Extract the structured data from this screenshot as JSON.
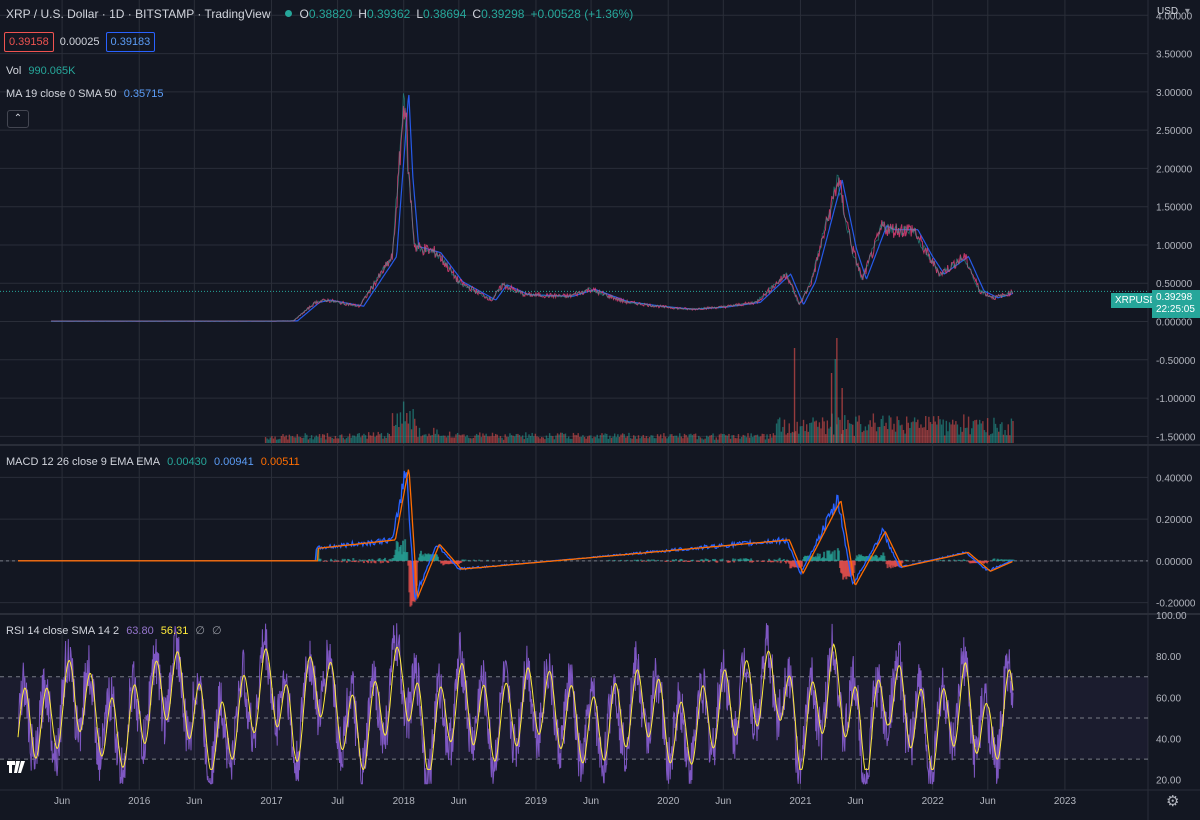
{
  "header": {
    "title": "XRP / U.S. Dollar · 1D · BITSTAMP · TradingView",
    "ohlc": [
      {
        "k": "O",
        "v": "0.38820"
      },
      {
        "k": "H",
        "v": "0.39362"
      },
      {
        "k": "L",
        "v": "0.38694"
      },
      {
        "k": "C",
        "v": "0.39298"
      }
    ],
    "change": "+0.00528 (+1.36%)",
    "bid": "0.39158",
    "spread": "0.00025",
    "ask": "0.39183"
  },
  "indicators": {
    "vol_label": "Vol",
    "vol_value": "990.065K",
    "ma_label": "MA 19 close 0 SMA 50",
    "ma_value": "0.35715",
    "macd_label": "MACD 12 26 close 9 EMA EMA",
    "macd_values": [
      "0.00430",
      "0.00941",
      "0.00511"
    ],
    "rsi_label": "RSI 14 close SMA 14 2",
    "rsi_values": [
      "63.80",
      "56.31",
      "∅",
      "∅"
    ]
  },
  "price_axis": {
    "currency": "USD",
    "ticks": [
      "4.00000",
      "3.50000",
      "3.00000",
      "2.50000",
      "2.00000",
      "1.50000",
      "1.00000",
      "0.50000",
      "0.00000",
      "-0.50000",
      "-1.00000",
      "-1.50000"
    ],
    "symbol_tag": "XRPUSD",
    "last_price": "0.39298",
    "countdown": "22:25:05"
  },
  "macd_axis": {
    "ticks": [
      "0.40000",
      "0.20000",
      "0.00000",
      "-0.20000"
    ]
  },
  "rsi_axis": {
    "ticks": [
      "100.00",
      "80.00",
      "60.00",
      "40.00",
      "20.00"
    ]
  },
  "time_axis": [
    "Jun",
    "2016",
    "Jun",
    "2017",
    "Jul",
    "2018",
    "Jun",
    "2019",
    "Jun",
    "2020",
    "Jun",
    "2021",
    "Jun",
    "2022",
    "Jun",
    "2023"
  ],
  "colors": {
    "background": "#131722",
    "grid": "#2a2e39",
    "up": "#26a69a",
    "down": "#ef5350",
    "macd_line": "#2962ff",
    "signal_line": "#ff6d00",
    "rsi_line": "#7e57c2",
    "rsi_ma": "#ffeb3b",
    "ma_line": "#2962ff"
  },
  "chart_data": [
    {
      "type": "line",
      "name": "price",
      "x": [
        "2015-05",
        "2016-01",
        "2016-06",
        "2017-01",
        "2017-03",
        "2017-05",
        "2017-06",
        "2017-09",
        "2017-12",
        "2018-01-04",
        "2018-01-15",
        "2018-02",
        "2018-04",
        "2018-06",
        "2018-09",
        "2018-10",
        "2018-12",
        "2019-04",
        "2019-06",
        "2019-09",
        "2019-12",
        "2020-03",
        "2020-06",
        "2020-09",
        "2020-11-24",
        "2020-12-29",
        "2021-02-01",
        "2021-04-14",
        "2021-05-23",
        "2021-06-20",
        "2021-08-15",
        "2021-09-06",
        "2021-11-10",
        "2021-12-20",
        "2022-01-22",
        "2022-03-28",
        "2022-05-10",
        "2022-06-18",
        "2022-07-20",
        "2022-08-11"
      ],
      "y": [
        0.006,
        0.006,
        0.006,
        0.006,
        0.008,
        0.25,
        0.28,
        0.2,
        0.85,
        3.0,
        1.9,
        0.98,
        0.9,
        0.52,
        0.28,
        0.48,
        0.35,
        0.33,
        0.42,
        0.26,
        0.2,
        0.16,
        0.19,
        0.25,
        0.62,
        0.22,
        0.52,
        1.85,
        0.95,
        0.55,
        1.25,
        1.2,
        1.2,
        0.85,
        0.62,
        0.85,
        0.4,
        0.31,
        0.35,
        0.39298
      ],
      "ylim": [
        -1.6,
        4.2
      ]
    },
    {
      "type": "line",
      "name": "MACD",
      "x": [
        "2017-05",
        "2017-12",
        "2018-01-08",
        "2018-02",
        "2018-04",
        "2018-06",
        "2020-11-24",
        "2021-01",
        "2021-04-14",
        "2021-05-23",
        "2021-08-15",
        "2021-10",
        "2022-04",
        "2022-06",
        "2022-08-11"
      ],
      "y": [
        0.06,
        0.1,
        0.45,
        -0.18,
        0.08,
        -0.04,
        0.1,
        -0.06,
        0.29,
        -0.12,
        0.14,
        -0.03,
        0.04,
        -0.05,
        0.0043
      ],
      "ylim": [
        -0.25,
        0.55
      ]
    },
    {
      "type": "line",
      "name": "RSI",
      "x": [
        "2015-05",
        "2015-07",
        "2015-11",
        "2016-04",
        "2016-08",
        "2017-01",
        "2017-03",
        "2017-05",
        "2017-09",
        "2018-01",
        "2018-03",
        "2018-06",
        "2018-09",
        "2019-01",
        "2019-06",
        "2019-11",
        "2020-02",
        "2020-06",
        "2020-11",
        "2021-01",
        "2021-04",
        "2021-07",
        "2021-09",
        "2022-01",
        "2022-04",
        "2022-06",
        "2022-08"
      ],
      "y": [
        45,
        78,
        30,
        88,
        25,
        90,
        30,
        92,
        28,
        95,
        25,
        72,
        40,
        70,
        35,
        68,
        30,
        62,
        85,
        30,
        88,
        25,
        78,
        32,
        70,
        28,
        63.8
      ],
      "ylim": [
        15,
        100
      ]
    }
  ]
}
